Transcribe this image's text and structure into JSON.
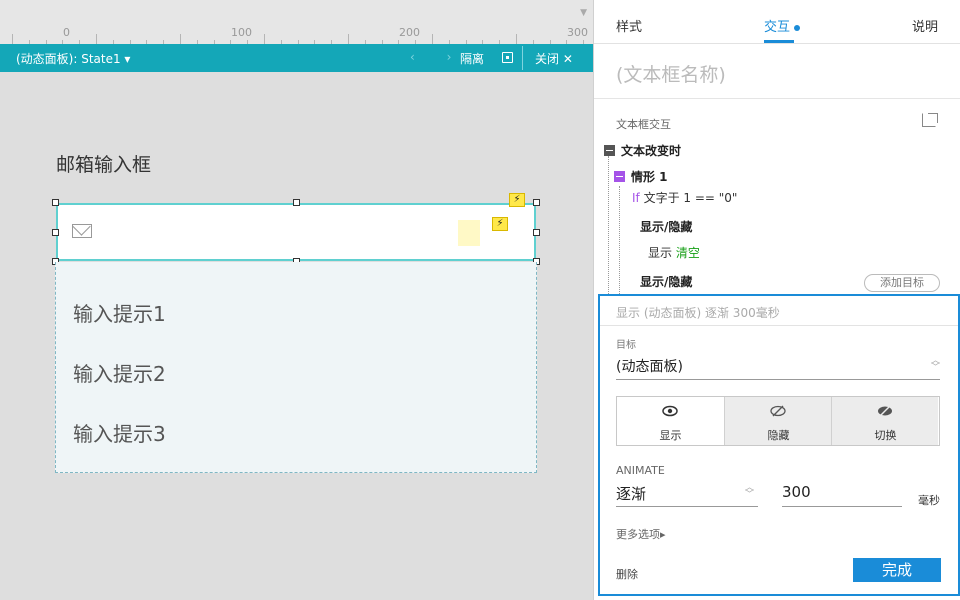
{
  "ruler": {
    "labels": [
      "0",
      "100",
      "200",
      "300"
    ]
  },
  "panel_bar": {
    "state_label": "(动态面板): State1 ▾",
    "nav_arrows": "‹ ›",
    "isolate_label": "隔离",
    "close_label": "关闭 ✕"
  },
  "canvas": {
    "field_title": "邮箱输入框",
    "event_badge": "⚡",
    "hints": [
      "输入提示1",
      "输入提示2",
      "输入提示3"
    ]
  },
  "sidebar": {
    "tabs": {
      "style": "样式",
      "interaction": "交互",
      "notes": "说明"
    },
    "name_placeholder": "(文本框名称)",
    "section_title": "文本框交互",
    "tree": {
      "event": "文本改变时",
      "case": "情形 1",
      "condition_keyword": "If",
      "condition_text": "文字于 1 == \"0\"",
      "action1_title": "显示/隐藏",
      "action1_detail_prefix": "显示",
      "action1_detail_target": "清空",
      "action2_title": "显示/隐藏",
      "add_target": "添加目标"
    },
    "editor": {
      "summary": "显示 (动态面板) 逐渐 300毫秒",
      "target_label": "目标",
      "target_value": "(动态面板)",
      "visibility_options": [
        "显示",
        "隐藏",
        "切换"
      ],
      "selected_visibility": "显示",
      "animate_label": "ANIMATE",
      "animate_value": "逐渐",
      "duration_value": "300",
      "duration_unit": "毫秒",
      "more_options": "更多选项▸",
      "delete_label": "删除",
      "done_label": "完成"
    }
  },
  "colors": {
    "accent_blue": "#1a8cd8",
    "panel_teal": "#14a7b8",
    "case_purple": "#a553e8",
    "target_green": "#18a018"
  }
}
